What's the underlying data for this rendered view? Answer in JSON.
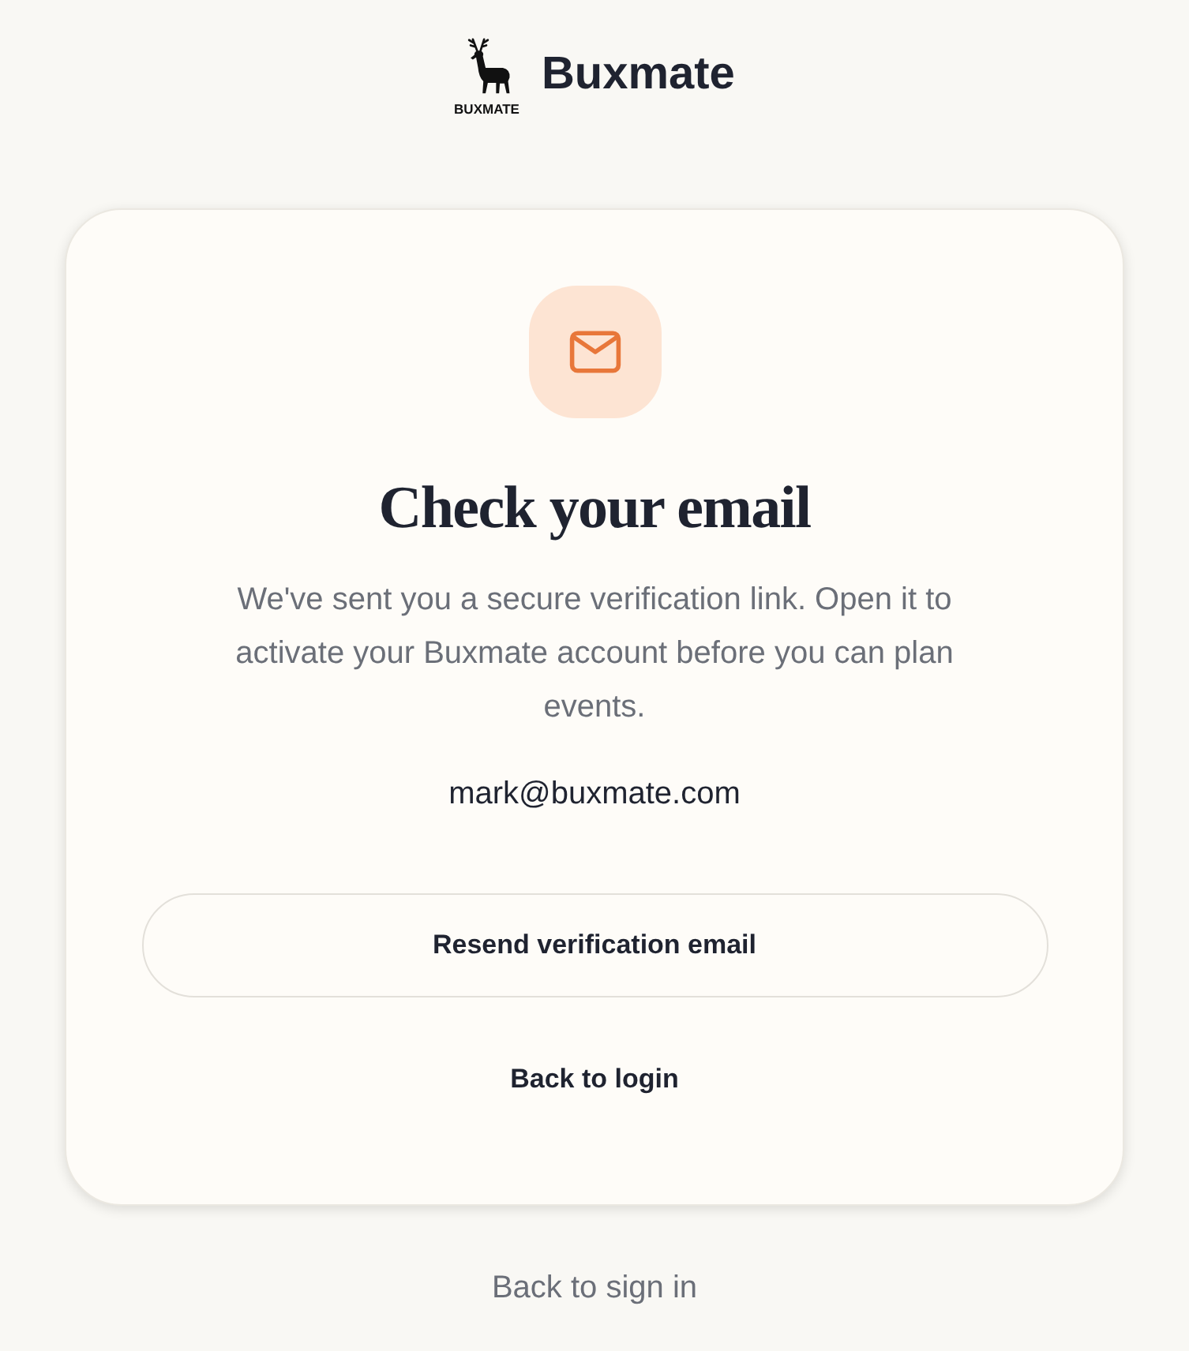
{
  "header": {
    "logo_caption": "BUXMATE",
    "brand": "Buxmate"
  },
  "card": {
    "title": "Check your email",
    "message": "We've sent you a secure verification link. Open it to activate your Buxmate account before you can plan events.",
    "email": "mark@buxmate.com",
    "primary_button": "Resend verification email",
    "secondary_link": "Back to login"
  },
  "footer_link": "Back to sign in"
}
